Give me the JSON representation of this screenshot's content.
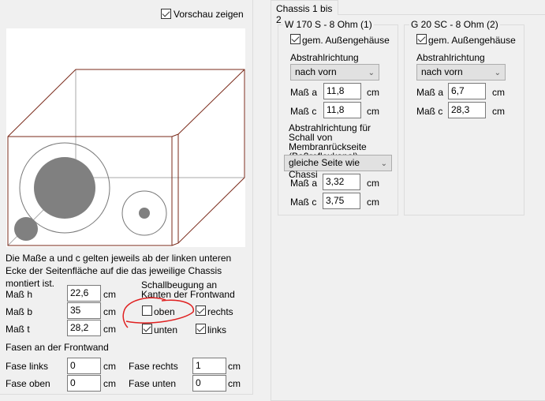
{
  "preview": {
    "show_label": "Vorschau zeigen",
    "show_checked": true
  },
  "info_text": "Die Maße a und c gelten jeweils ab der linken unteren Ecke der Seitenfläche auf die das jeweilige Chassis montiert ist.",
  "dims": [
    {
      "label": "Maß h",
      "value": "22,6",
      "unit": "cm"
    },
    {
      "label": "Maß b",
      "value": "35",
      "unit": "cm"
    },
    {
      "label": "Maß t",
      "value": "28,2",
      "unit": "cm"
    }
  ],
  "diffraction": {
    "title": "Schallbeugung an Kanten der Frontwand",
    "oben": "oben",
    "rechts": "rechts",
    "unten": "unten",
    "links": "links",
    "oben_checked": false,
    "rechts_checked": true,
    "unten_checked": true,
    "links_checked": true
  },
  "bevels": {
    "title": "Fasen an der Frontwand",
    "links_label": "Fase links",
    "links_value": "0",
    "rechts_label": "Fase rechts",
    "rechts_value": "1",
    "oben_label": "Fase oben",
    "oben_value": "0",
    "unten_label": "Fase unten",
    "unten_value": "0",
    "unit": "cm"
  },
  "tab": {
    "label": "Chassis 1 bis 2"
  },
  "chassis1": {
    "title": "W 170 S - 8 Ohm (1)",
    "shared_label": "gem. Außengehäuse",
    "dir_label": "Abstrahlrichtung",
    "dir_value": "nach vorn",
    "a_label": "Maß a",
    "a_value": "11,8",
    "c_label": "Maß c",
    "c_value": "11,8",
    "unit": "cm",
    "rear_label": "Abstrahlrichtung für Schall von Membranrückseite (Baßreflexkanal)",
    "rear_value": "gleiche Seite wie Chassi",
    "ra_value": "3,32",
    "rc_value": "3,75"
  },
  "chassis2": {
    "title": "G 20 SC - 8 Ohm (2)",
    "shared_label": "gem. Außengehäuse",
    "dir_label": "Abstrahlrichtung",
    "dir_value": "nach vorn",
    "a_label": "Maß a",
    "a_value": "6,7",
    "c_label": "Maß c",
    "c_value": "28,3",
    "unit": "cm"
  }
}
